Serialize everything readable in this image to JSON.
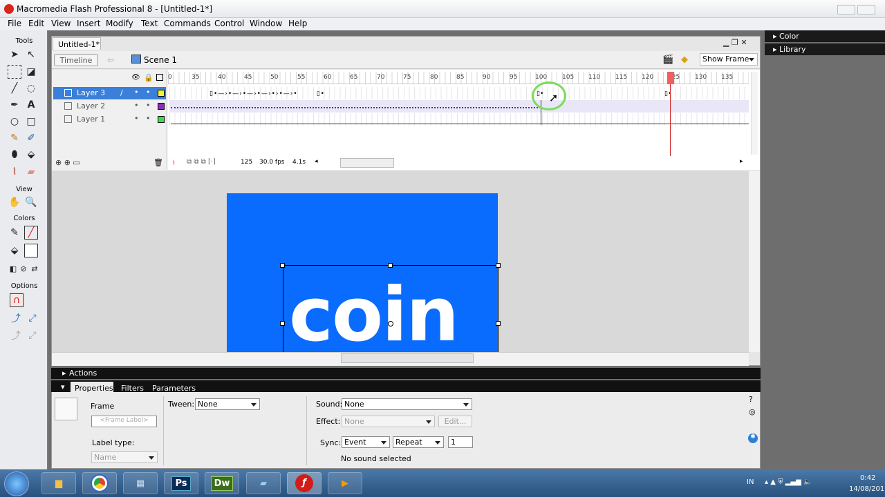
{
  "window": {
    "title": "Macromedia Flash Professional 8 - [Untitled-1*]"
  },
  "menu": [
    "File",
    "Edit",
    "View",
    "Insert",
    "Modify",
    "Text",
    "Commands",
    "Control",
    "Window",
    "Help"
  ],
  "tools": {
    "header": "Tools",
    "view": "View",
    "colors": "Colors",
    "options": "Options"
  },
  "document": {
    "tab": "Untitled-1*",
    "timeline_button": "Timeline",
    "scene": "Scene 1",
    "zoom": "Show Frame"
  },
  "layers": [
    {
      "name": "Layer 3",
      "color": "#f2f238",
      "selected": true
    },
    {
      "name": "Layer 2",
      "color": "#8a2fb8",
      "selected": false
    },
    {
      "name": "Layer 1",
      "color": "#3fd94a",
      "selected": false
    }
  ],
  "ruler": [
    "0",
    "35",
    "40",
    "45",
    "50",
    "55",
    "60",
    "65",
    "70",
    "75",
    "80",
    "85",
    "90",
    "95",
    "100",
    "105",
    "110",
    "115",
    "120",
    "125",
    "130",
    "135"
  ],
  "status": {
    "frame": "125",
    "fps": "30.0 fps",
    "time": "4.1s"
  },
  "stage": {
    "text": "coin",
    "background": "#0a6bff"
  },
  "panels": {
    "actions": "Actions",
    "color": "Color",
    "library": "Library"
  },
  "properties": {
    "tabs": [
      "Properties",
      "Filters",
      "Parameters"
    ],
    "frame_label": "Frame",
    "frame_placeholder": "<Frame Label>",
    "label_type_label": "Label type:",
    "label_type_value": "Name",
    "tween_label": "Tween:",
    "tween_value": "None",
    "sound_label": "Sound:",
    "sound_value": "None",
    "effect_label": "Effect:",
    "effect_value": "None",
    "edit_button": "Edit...",
    "sync_label": "Sync:",
    "sync_value": "Event",
    "repeat_value": "Repeat",
    "repeat_count": "1",
    "no_sound": "No sound selected"
  },
  "taskbar": {
    "apps": [
      "Ps",
      "Dw"
    ],
    "lang": "IN",
    "time": "0:42",
    "date": "14/08/201"
  }
}
